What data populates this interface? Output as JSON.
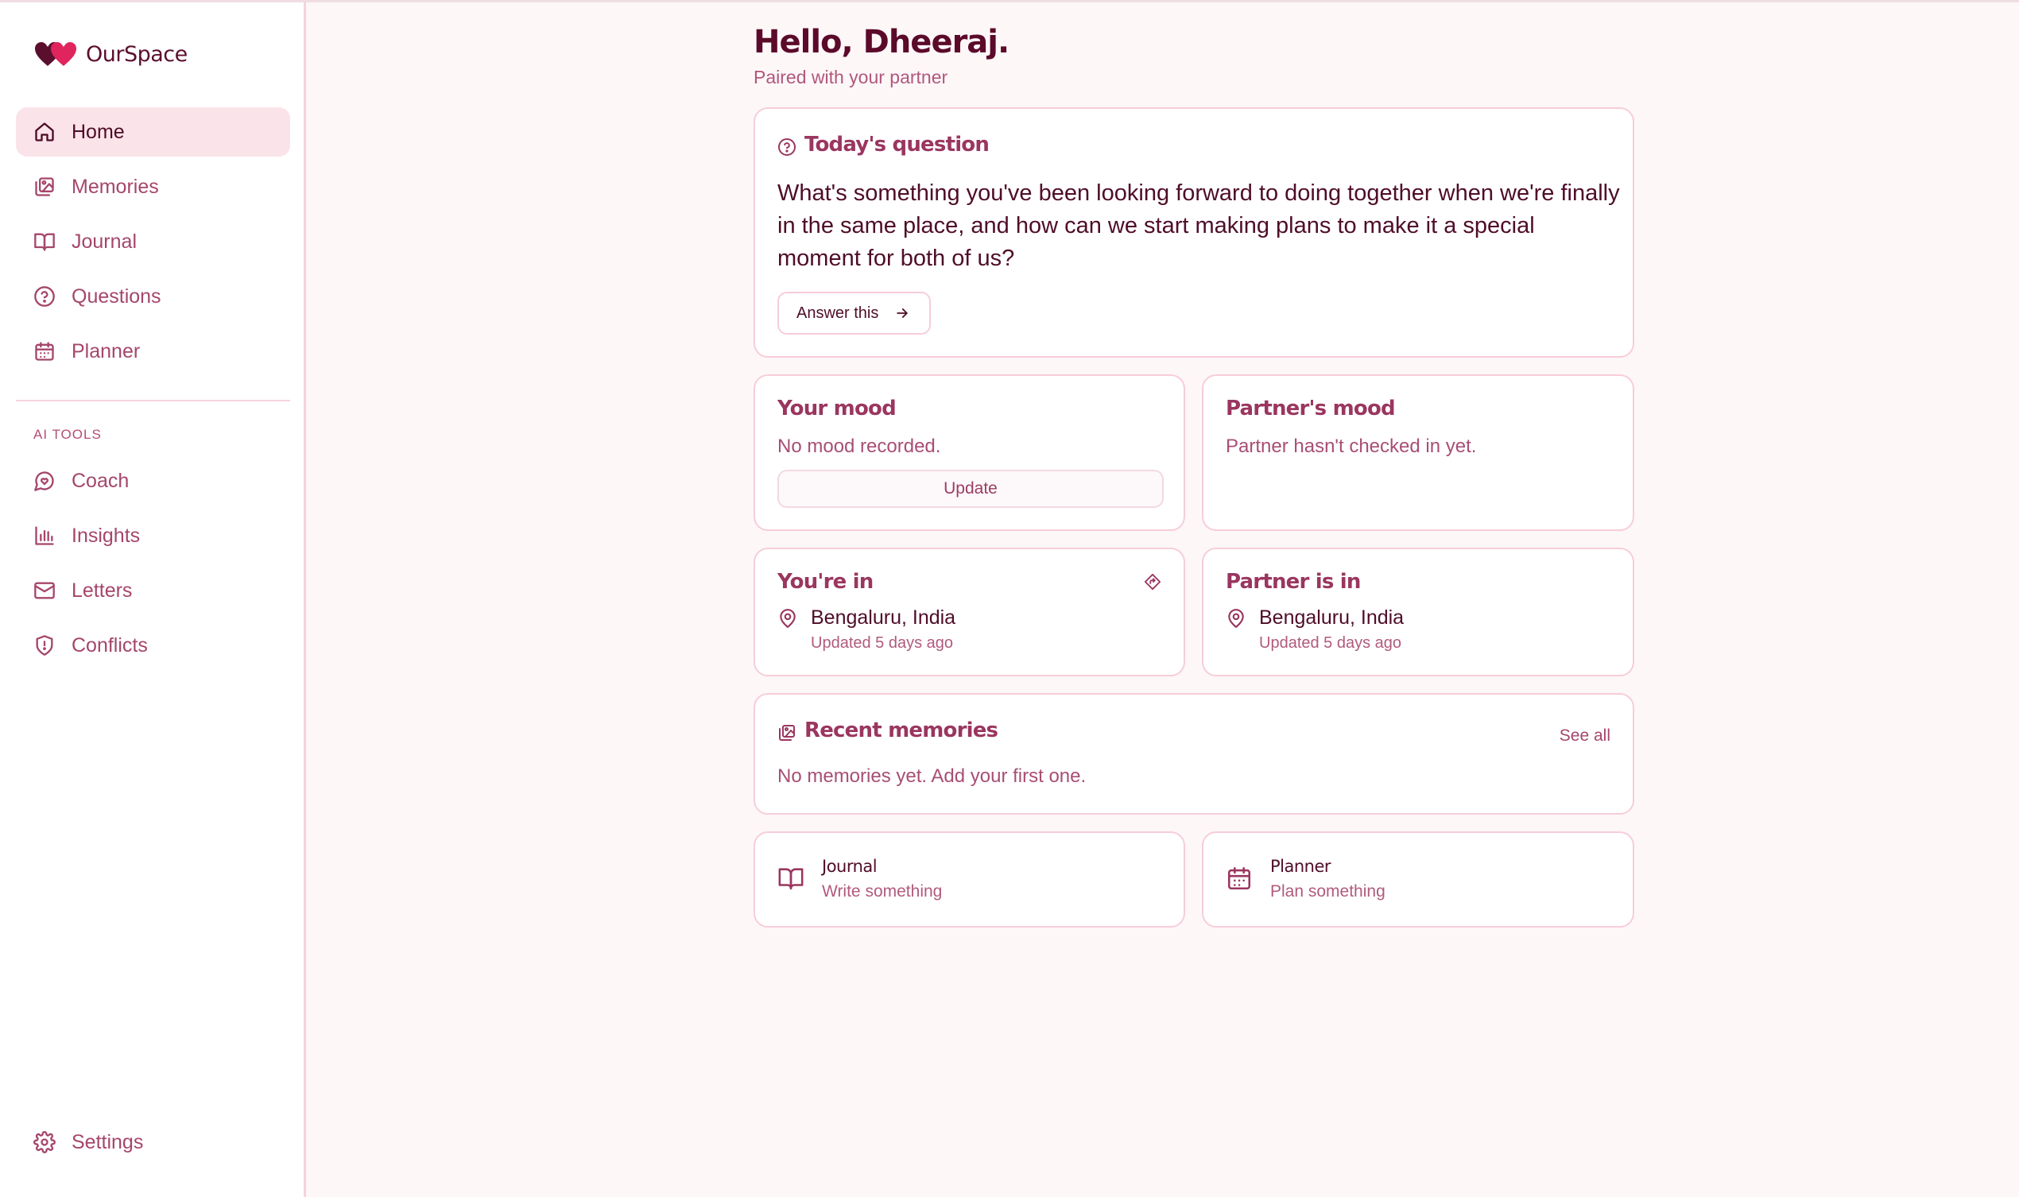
{
  "app": {
    "name": "OurSpace"
  },
  "sidebar": {
    "items": [
      {
        "label": "Home",
        "icon": "home-icon",
        "active": true
      },
      {
        "label": "Memories",
        "icon": "gallery-icon"
      },
      {
        "label": "Journal",
        "icon": "book-icon"
      },
      {
        "label": "Questions",
        "icon": "question-icon"
      },
      {
        "label": "Planner",
        "icon": "calendar-icon"
      }
    ],
    "ai_tools_label": "AI TOOLS",
    "ai_items": [
      {
        "label": "Coach",
        "icon": "chat-icon"
      },
      {
        "label": "Insights",
        "icon": "bar-chart-icon"
      },
      {
        "label": "Letters",
        "icon": "mail-icon"
      },
      {
        "label": "Conflicts",
        "icon": "shield-icon"
      }
    ],
    "settings_label": "Settings"
  },
  "header": {
    "greeting": "Hello, Dheeraj.",
    "subtitle": "Paired with your partner"
  },
  "question_card": {
    "title": "Today's question",
    "text": "What's something you've been looking forward to doing together when we're finally in the same place, and how can we start making plans to make it a special moment for both of us?",
    "button": "Answer this"
  },
  "your_mood": {
    "title": "Your mood",
    "status": "No mood recorded.",
    "button": "Update"
  },
  "partner_mood": {
    "title": "Partner's mood",
    "status": "Partner hasn't checked in yet."
  },
  "your_location": {
    "title": "You're in",
    "city": "Bengaluru, India",
    "updated": "Updated 5 days ago"
  },
  "partner_location": {
    "title": "Partner is in",
    "city": "Bengaluru, India",
    "updated": "Updated 5 days ago"
  },
  "recent_memories": {
    "title": "Recent memories",
    "see_all": "See all",
    "empty": "No memories yet. Add your first one."
  },
  "quick_links": [
    {
      "title": "Journal",
      "subtitle": "Write something",
      "icon": "book-icon"
    },
    {
      "title": "Planner",
      "subtitle": "Plan something",
      "icon": "calendar-icon"
    }
  ],
  "colors": {
    "accent": "#a5466b",
    "dark": "#4f0d28",
    "border": "#f7cdd9",
    "active_bg": "#fbe3ea",
    "background": "#fdf7f8"
  }
}
